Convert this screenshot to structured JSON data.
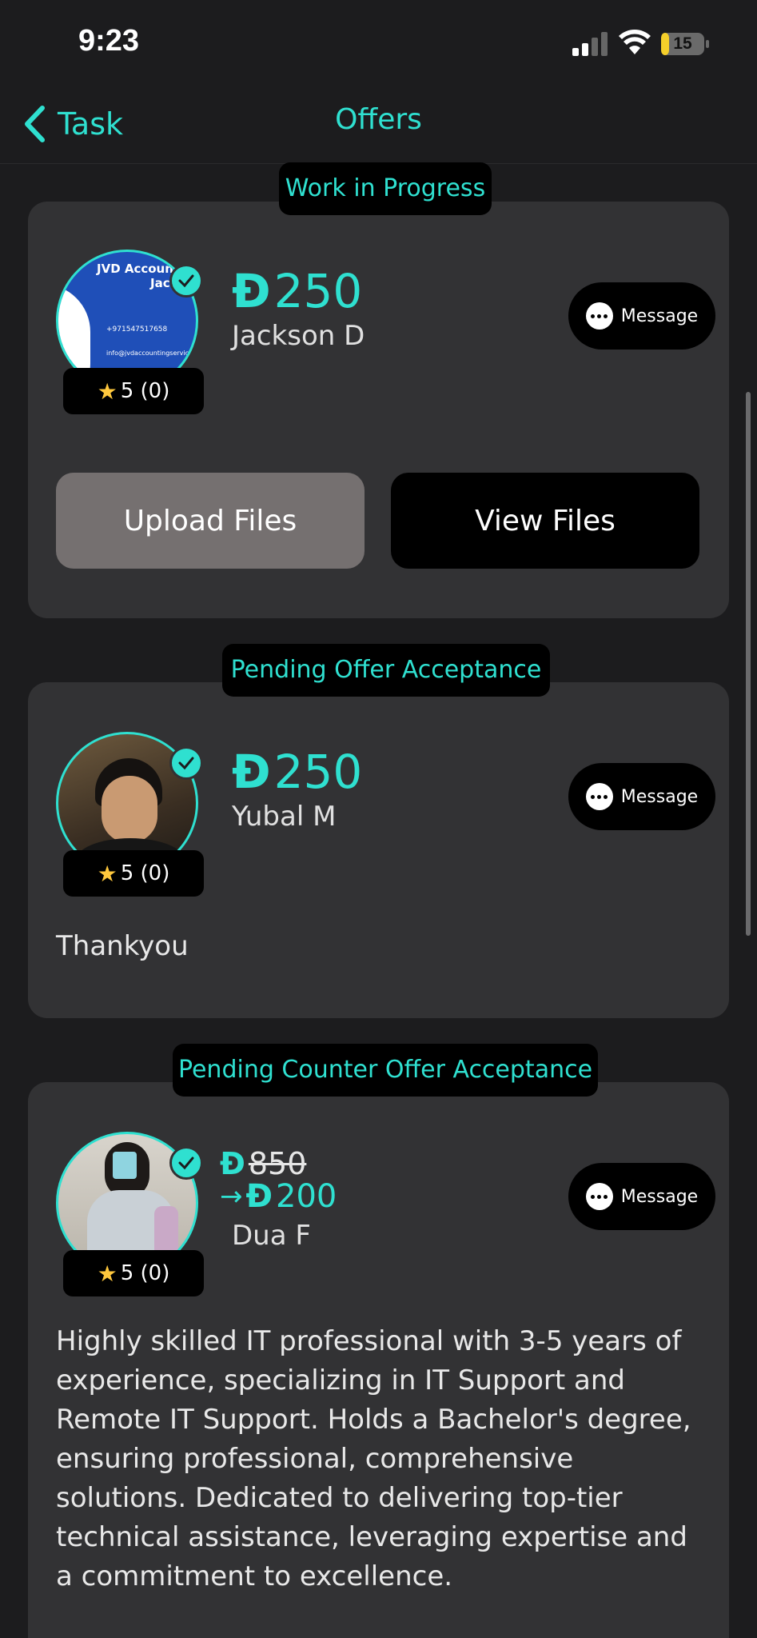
{
  "status_bar": {
    "time": "9:23",
    "battery": "15"
  },
  "nav": {
    "back_label": "Task",
    "title": "Offers"
  },
  "currency_symbol": "Đ",
  "offers": [
    {
      "status": "Work in Progress",
      "price": "250",
      "name": "Jackson  D",
      "rating": "5 (0)",
      "message_label": "Message",
      "upload_label": "Upload Files",
      "view_label": "View Files",
      "avatar_text": {
        "line1": "JVD Accoun",
        "line2": "Jac",
        "phone": "+971547517658",
        "email": "info@jvdaccountingservice"
      }
    },
    {
      "status": "Pending Offer Acceptance",
      "price": "250",
      "name": "Yubal M",
      "rating": "5 (0)",
      "message_label": "Message",
      "note": "Thankyou"
    },
    {
      "status": "Pending Counter Offer Acceptance",
      "old_price": "850",
      "arrow": "→",
      "price": "200",
      "name": "Dua  F",
      "rating": "5 (0)",
      "message_label": "Message",
      "note": "Highly skilled IT professional with 3-5 years of experience, specializing in IT Support and Remote IT Support. Holds a Bachelor's degree, ensuring professional, comprehensive solutions. Dedicated to delivering top-tier technical assistance, leveraging expertise and a commitment to excellence."
    }
  ],
  "colors": {
    "accent": "#2fe0d0",
    "card": "#323234",
    "background": "#1c1c1e",
    "star": "#ffc83d",
    "upload_button": "#757070"
  }
}
